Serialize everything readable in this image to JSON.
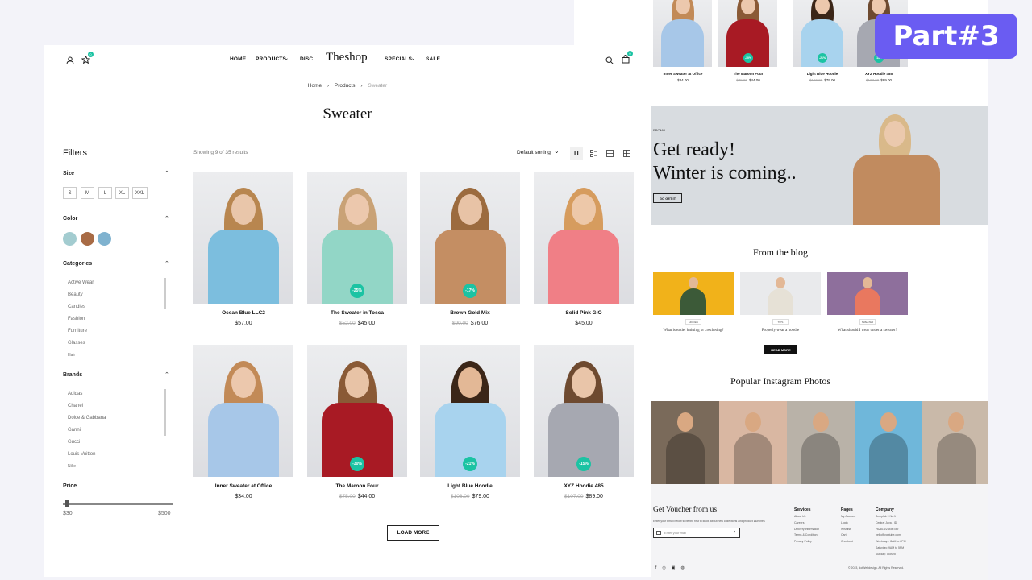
{
  "header": {
    "nav_left": [
      "HOME",
      "PRODUCTS",
      "DISC"
    ],
    "logo": "Theshop",
    "nav_right": [
      "SPECIALS",
      "SALE"
    ],
    "wishlist_count": "0",
    "cart_count": "0"
  },
  "breadcrumb": [
    "Home",
    "Products",
    "Sweater"
  ],
  "page_title": "Sweater",
  "filters": {
    "title": "Filters",
    "size_label": "Size",
    "sizes": [
      "S",
      "M",
      "L",
      "XL",
      "XXL"
    ],
    "color_label": "Color",
    "colors": [
      "#a3ccd0",
      "#a86b45",
      "#7fb2cf"
    ],
    "categories_label": "Categories",
    "categories": [
      "Active Wear",
      "Beauty",
      "Candles",
      "Fashion",
      "Furniture",
      "Glasses",
      "Hair"
    ],
    "brands_label": "Brands",
    "brands": [
      "Adidas",
      "Chanel",
      "Dolce & Gabbana",
      "Ganni",
      "Gucci",
      "Louis Vuitton",
      "Nike"
    ],
    "price_label": "Price",
    "price_min": "$30",
    "price_max": "$500",
    "price_level": 0.02
  },
  "toolbar": {
    "results": "Showing 9 of 35 results",
    "sort": "Default sorting"
  },
  "products": [
    {
      "name": "Ocean Blue LLC2",
      "old": "",
      "price": "$57.00",
      "badge": "",
      "sweater": "#7cbede",
      "hair": "#b8864f",
      "skin": "#e9c6aa"
    },
    {
      "name": "The Sweater in Tosca",
      "old": "$52.00",
      "price": "$45.00",
      "badge": "-25%",
      "sweater": "#92d6c6",
      "hair": "#c9a276",
      "skin": "#ecc8ad"
    },
    {
      "name": "Brown Gold Mix",
      "old": "$90.00",
      "price": "$76.00",
      "badge": "-17%",
      "sweater": "#c48e63",
      "hair": "#9c6b3e",
      "skin": "#e8c3a6"
    },
    {
      "name": "Solid Pink GIO",
      "old": "",
      "price": "$45.00",
      "badge": "",
      "sweater": "#f07f86",
      "hair": "#d69c5e",
      "skin": "#edc8a9"
    },
    {
      "name": "Inner Sweater at Office",
      "old": "",
      "price": "$34.00",
      "badge": "",
      "sweater": "#a7c7e8",
      "hair": "#c28a57",
      "skin": "#ecc8ad"
    },
    {
      "name": "The Maroon Four",
      "old": "$75.00",
      "price": "$44.00",
      "badge": "-30%",
      "sweater": "#a81a24",
      "hair": "#8a5a36",
      "skin": "#e8c3a6"
    },
    {
      "name": "Light Blue Hoodie",
      "old": "$106.00",
      "price": "$79.00",
      "badge": "-21%",
      "sweater": "#a8d3ee",
      "hair": "#3b2618",
      "skin": "#e3b896"
    },
    {
      "name": "XYZ Hoodie 485",
      "old": "$107.00",
      "price": "$89.00",
      "badge": "-15%",
      "sweater": "#a6a8b1",
      "hair": "#6e4a30",
      "skin": "#e9c5a9"
    }
  ],
  "load_more": "LOAD MORE",
  "part_badge": "Part#3",
  "right": {
    "top_products": [
      {
        "name": "Inner Sweater at Office",
        "old": "",
        "price": "$34.00",
        "badge": "",
        "sweater": "#a7c7e8",
        "hair": "#c28a57"
      },
      {
        "name": "The Maroon Four",
        "old": "$75.00",
        "price": "$44.00",
        "badge": "-30%",
        "sweater": "#a81a24",
        "hair": "#8a5a36"
      },
      {
        "name": "Light Blue Hoodie",
        "old": "$106.00",
        "price": "$79.00",
        "badge": "-21%",
        "sweater": "#a8d3ee",
        "hair": "#3b2618"
      },
      {
        "name": "XYZ Hoodie 485",
        "old": "$107.00",
        "price": "$89.00",
        "badge": "-15%",
        "sweater": "#a6a8b1",
        "hair": "#6e4a30"
      }
    ],
    "promo_tag": "PROMO",
    "promo_line1": "Get ready!",
    "promo_line2": "Winter is coming..",
    "promo_button": "GO GET IT",
    "blog_title": "From the blog",
    "blog_posts": [
      {
        "tag": "HIDDEN",
        "title": "What is easier knitting or crocheting?",
        "bg": "#f1b21a",
        "sweater": "#3c5a38"
      },
      {
        "tag": "TIPS",
        "title": "Properly wear a hoodie",
        "bg": "#e9eaec",
        "sweater": "#e6e1d6"
      },
      {
        "tag": "SWEATER",
        "title": "What should I wear under a sweater?",
        "bg": "#8e6f9c",
        "sweater": "#e9785f"
      }
    ],
    "read_more": "READ MORE",
    "insta_title": "Popular Instagram Photos",
    "insta": [
      "#7a6a5a",
      "#d9b7a2",
      "#b9b2a8",
      "#6fb7da",
      "#c9b9a9"
    ],
    "voucher_title": "Get Voucher from us",
    "voucher_text": "Enter your email below to be the first to know about new collections and product launches",
    "email_placeholder": "Enter your mail",
    "col_services": {
      "title": "Services",
      "items": [
        "About Us",
        "Careers",
        "Delivery Information",
        "Terms & Condition",
        "Privacy Policy"
      ]
    },
    "col_pages": {
      "title": "Pages",
      "items": [
        "My Account",
        "Login",
        "Wishlist",
        "Cart",
        "Checkout"
      ]
    },
    "col_company": {
      "title": "Company",
      "items": [
        "Semplak II No.1",
        "Central Java - ID",
        "+62815/23456789",
        "hello@youtube.com",
        "Weekdays: 8AM to 6PM",
        "Saturday: 9AM to 5PM",
        "Sunday: Closed"
      ]
    },
    "copyright": "© 2023, dotWebdesign. All Rights Reserved."
  }
}
